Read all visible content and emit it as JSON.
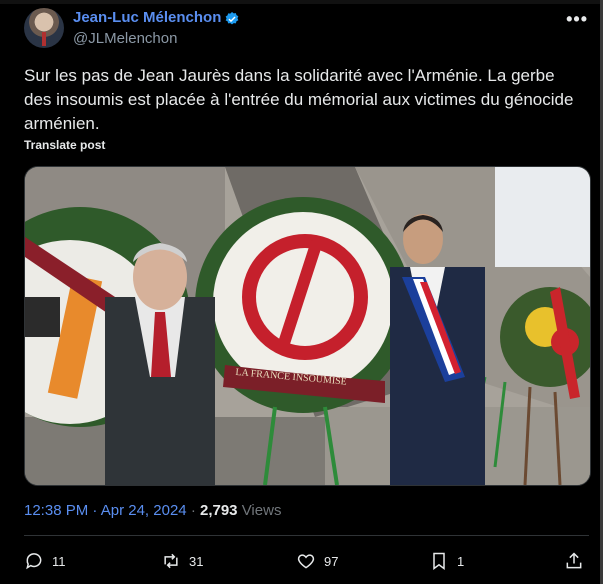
{
  "author": {
    "name": "Jean-Luc Mélenchon",
    "handle": "@JLMelenchon"
  },
  "tweet": {
    "text": "Sur les pas de Jean Jaurès dans la solidarité avec l'Arménie. La gerbe des insoumis est placée à l'entrée du mémorial aux victimes du génocide arménien.",
    "translate_label": "Translate post",
    "banner_text": "LA FRANCE INSOUMISE"
  },
  "meta": {
    "time": "12:38 PM",
    "separator": "·",
    "date": "Apr 24, 2024",
    "views_count": "2,793",
    "views_label": "Views"
  },
  "actions": {
    "replies": "11",
    "reposts": "31",
    "likes": "97",
    "bookmarks": "1"
  },
  "icons": {
    "verified": "verified-badge-icon",
    "more": "more-dots-icon",
    "reply": "reply-icon",
    "repost": "repost-icon",
    "like": "heart-icon",
    "bookmark": "bookmark-icon",
    "share": "share-icon"
  },
  "colors": {
    "background": "#000000",
    "link": "#5a8ef0",
    "text": "#e7e9ea",
    "muted": "#71767b",
    "verified": "#1d9bf0"
  }
}
